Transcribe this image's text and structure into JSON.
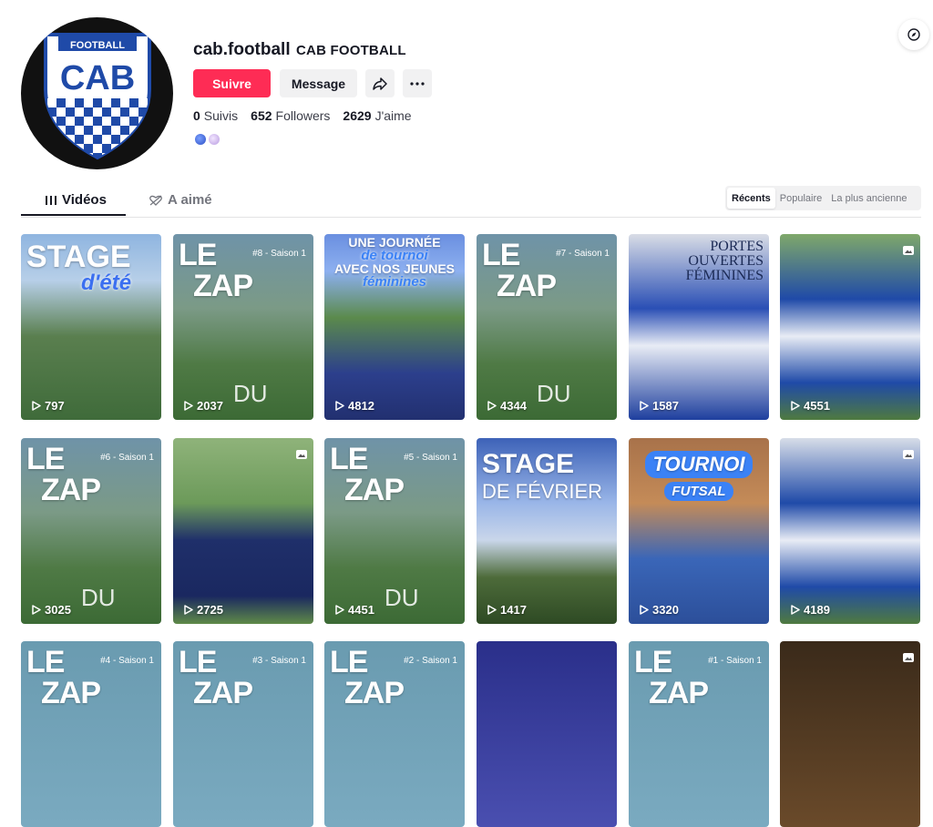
{
  "profile": {
    "username": "cab.football",
    "nickname": "CAB FOOTBALL",
    "logo_top": "FOOTBALL",
    "logo_main": "CAB",
    "follow_label": "Suivre",
    "message_label": "Message",
    "stats": {
      "following_count": "0",
      "following_label": "Suivis",
      "followers_count": "652",
      "followers_label": "Followers",
      "likes_count": "2629",
      "likes_label": "J'aime"
    }
  },
  "tabs": {
    "videos": "Vidéos",
    "liked": "A aimé"
  },
  "sort": {
    "recent": "Récents",
    "popular": "Populaire",
    "oldest": "La plus ancienne"
  },
  "colors": {
    "accent": "#fe2c55",
    "brand_blue": "#1f4aa8"
  },
  "videos": [
    {
      "title": "STAGE",
      "title2": "d'été",
      "views": "797",
      "subtitle": ""
    },
    {
      "title": "LE ZAP",
      "title2": "DU",
      "views": "2037",
      "subtitle": "#8 - Saison 1"
    },
    {
      "title": "UNE JOURNÉE",
      "title2": "de tournoi",
      "title3": "AVEC NOS JEUNES",
      "title4": "féminines",
      "views": "4812",
      "subtitle": ""
    },
    {
      "title": "LE ZAP",
      "title2": "DU",
      "views": "4344",
      "subtitle": "#7 - Saison 1"
    },
    {
      "title": "PORTES OUVERTES",
      "title2": "FÉMININES",
      "views": "1587",
      "subtitle": ""
    },
    {
      "title": "",
      "title2": "",
      "views": "4551",
      "subtitle": ""
    },
    {
      "title": "LE ZAP",
      "title2": "DU",
      "views": "3025",
      "subtitle": "#6 - Saison 1"
    },
    {
      "title": "",
      "title2": "",
      "views": "2725",
      "subtitle": ""
    },
    {
      "title": "LE ZAP",
      "title2": "DU",
      "views": "4451",
      "subtitle": "#5 - Saison 1"
    },
    {
      "title": "STAGE",
      "title2": "DE FÉVRIER",
      "views": "1417",
      "subtitle": ""
    },
    {
      "title": "TOURNOI",
      "title2": "FUTSAL",
      "views": "3320",
      "subtitle": ""
    },
    {
      "title": "",
      "title2": "",
      "views": "4189",
      "subtitle": ""
    },
    {
      "title": "LE ZAP",
      "title2": "",
      "views": "",
      "subtitle": "#4 - Saison 1"
    },
    {
      "title": "LE ZAP",
      "title2": "",
      "views": "",
      "subtitle": "#3 - Saison 1"
    },
    {
      "title": "LE ZAP",
      "title2": "",
      "views": "",
      "subtitle": "#2 - Saison 1"
    },
    {
      "title": "",
      "title2": "",
      "views": "",
      "subtitle": ""
    },
    {
      "title": "LE ZAP",
      "title2": "",
      "views": "",
      "subtitle": "#1 - Saison 1"
    },
    {
      "title": "",
      "title2": "",
      "views": "",
      "subtitle": ""
    }
  ]
}
